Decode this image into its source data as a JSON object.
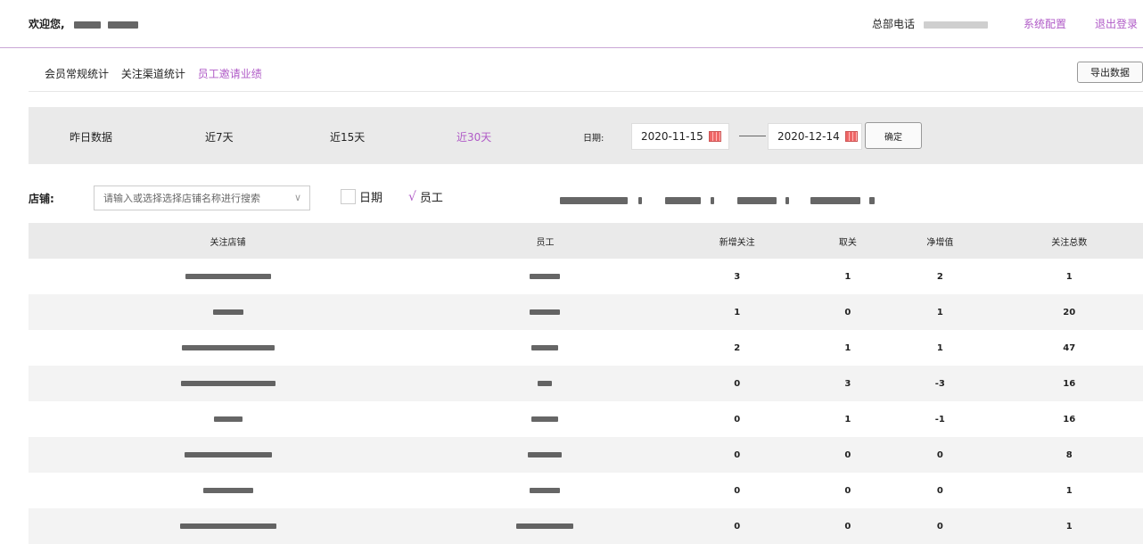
{
  "header": {
    "welcome": "欢迎您,",
    "hq_phone_label": "总部电话",
    "system_config": "系统配置",
    "logout": "退出登录"
  },
  "tabs": [
    {
      "label": "会员常规统计",
      "active": false
    },
    {
      "label": "关注渠道统计",
      "active": false
    },
    {
      "label": "员工邀请业绩",
      "active": true
    }
  ],
  "export_label": "导出数据",
  "filters": {
    "ranges": [
      "昨日数据",
      "近7天",
      "近15天",
      "近30天"
    ],
    "active_range": "近30天",
    "date_label": "日期:",
    "start_date": "2020-11-15",
    "end_date": "2020-12-14",
    "confirm": "确定"
  },
  "store_filter": {
    "label": "店铺:",
    "placeholder": "请输入或选择选择店铺名称进行搜索",
    "date_checkbox": "日期",
    "employee_checkbox": "员工",
    "employee_checked": true
  },
  "table": {
    "headers": [
      "关注店铺",
      "员工",
      "新增关注",
      "取关",
      "净增值",
      "关注总数"
    ],
    "rows": [
      {
        "new": "3",
        "unfollow": "1",
        "net": "2",
        "total": "1"
      },
      {
        "new": "1",
        "unfollow": "0",
        "net": "1",
        "total": "20"
      },
      {
        "new": "2",
        "unfollow": "1",
        "net": "1",
        "total": "47"
      },
      {
        "new": "0",
        "unfollow": "3",
        "net": "-3",
        "total": "16"
      },
      {
        "new": "0",
        "unfollow": "1",
        "net": "-1",
        "total": "16"
      },
      {
        "new": "0",
        "unfollow": "0",
        "net": "0",
        "total": "8"
      },
      {
        "new": "0",
        "unfollow": "0",
        "net": "0",
        "total": "1"
      },
      {
        "new": "0",
        "unfollow": "0",
        "net": "0",
        "total": "1"
      }
    ]
  },
  "colors": {
    "accent": "#b05bc7",
    "bar_bg": "#eaeaea"
  }
}
